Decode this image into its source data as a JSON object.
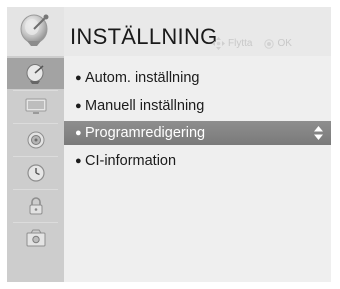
{
  "header": {
    "title": "INSTÄLLNING",
    "hint_move": "Flytta",
    "hint_ok": "OK",
    "icon": "satellite-dish-icon"
  },
  "sidebar": {
    "items": [
      {
        "name": "setup",
        "icon": "satellite-dish-icon",
        "active": true
      },
      {
        "name": "picture",
        "icon": "monitor-icon",
        "active": false
      },
      {
        "name": "audio",
        "icon": "speaker-icon",
        "active": false
      },
      {
        "name": "time",
        "icon": "clock-icon",
        "active": false
      },
      {
        "name": "lock",
        "icon": "padlock-icon",
        "active": false
      },
      {
        "name": "option",
        "icon": "options-icon",
        "active": false
      }
    ]
  },
  "menu": {
    "items": [
      {
        "label": "Autom. inställning",
        "selected": false
      },
      {
        "label": "Manuell inställning",
        "selected": false
      },
      {
        "label": "Programredigering",
        "selected": true
      },
      {
        "label": "CI-information",
        "selected": false
      }
    ]
  },
  "colors": {
    "panel_bg": "#eeeeee",
    "sidebar_bg": "#cdcdcd",
    "sidebar_active": "#a3a3a3",
    "selection": "#858585",
    "hint_text": "#c8c8c8"
  }
}
